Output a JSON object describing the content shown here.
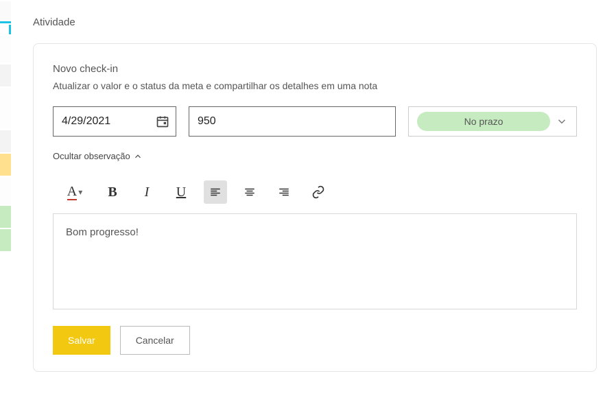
{
  "section": {
    "title": "Atividade"
  },
  "checkin": {
    "heading": "Novo check-in",
    "subheading": "Atualizar o valor e o status da meta e compartilhar os detalhes em uma nota",
    "date": "4/29/2021",
    "value": "950",
    "status": {
      "selected_label": "No prazo",
      "pill_color": "#c6ebc0"
    },
    "hide_obs_label": "Ocultar observação",
    "editor": {
      "content": "Bom progresso!"
    },
    "actions": {
      "save_label": "Salvar",
      "cancel_label": "Cancelar"
    }
  }
}
